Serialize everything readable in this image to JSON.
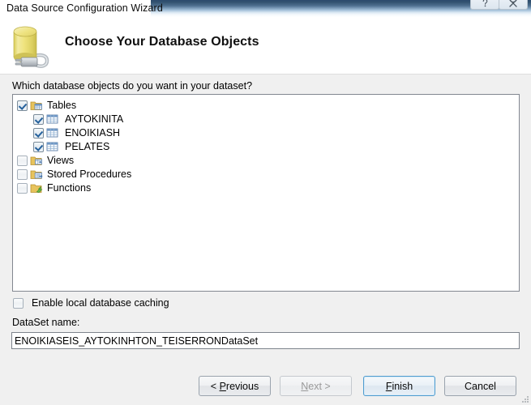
{
  "window": {
    "title": "Data Source Configuration Wizard",
    "help_button": "?",
    "close_button": "✕",
    "help_icon": "question-mark-icon",
    "close_icon": "close-x-icon"
  },
  "header": {
    "title": "Choose Your Database Objects",
    "icon": "database-cylinder-plug-icon"
  },
  "body": {
    "prompt": "Which database objects do you want in your dataset?"
  },
  "tree": {
    "items": [
      {
        "label": "Tables",
        "checked": true,
        "level": 0,
        "icon": "tables-folder-icon"
      },
      {
        "label": "AYTOKINITA",
        "checked": true,
        "level": 1,
        "icon": "table-grid-icon"
      },
      {
        "label": "ENOIKIASH",
        "checked": true,
        "level": 1,
        "icon": "table-grid-icon"
      },
      {
        "label": "PELATES",
        "checked": true,
        "level": 1,
        "icon": "table-grid-icon"
      },
      {
        "label": "Views",
        "checked": false,
        "level": 0,
        "icon": "views-folder-icon"
      },
      {
        "label": "Stored Procedures",
        "checked": false,
        "level": 0,
        "icon": "stored-procedures-folder-icon"
      },
      {
        "label": "Functions",
        "checked": false,
        "level": 0,
        "icon": "functions-folder-icon"
      }
    ]
  },
  "options": {
    "enable_caching_label": "Enable local database caching",
    "enable_caching_checked": false
  },
  "dataset": {
    "label": "DataSet name:",
    "value": "ENOIKIASEIS_AYTOKINHTON_TEISERRONDataSet"
  },
  "footer": {
    "previous": "< Previous",
    "previous_mnemonic": "P",
    "next": "Next >",
    "next_mnemonic": "N",
    "next_disabled": true,
    "finish": "Finish",
    "finish_mnemonic": "F",
    "finish_default": true,
    "cancel": "Cancel"
  },
  "colors": {
    "accent_blue": "#4f9ccf",
    "titlebar_blue": "#2c4a6e",
    "body_gray": "#f0f0f0",
    "db_icon_yellow": "#e8dd73",
    "check_blue": "#25619c"
  }
}
